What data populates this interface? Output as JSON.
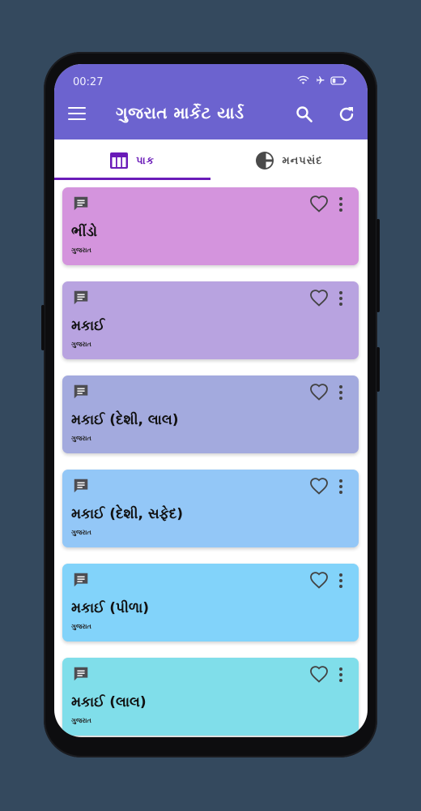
{
  "status_bar": {
    "time": "00:27"
  },
  "app_bar": {
    "title": "ગુજરાત માર્કેટ યાર્ડ"
  },
  "tabs": [
    {
      "label": "પાક",
      "icon": "table-icon",
      "active": true
    },
    {
      "label": "મનપસંદ",
      "icon": "pie-chart-icon",
      "active": false
    }
  ],
  "items": [
    {
      "name": "ભીંડો",
      "state": "ગુજરાત",
      "color": "#d494dd"
    },
    {
      "name": "મકાઈ",
      "state": "ગુજરાત",
      "color": "#b8a3e0"
    },
    {
      "name": "મકાઈ (દેશી, લાલ)",
      "state": "ગુજરાત",
      "color": "#a3aade"
    },
    {
      "name": "મકાઈ (દેશી, સફેદ)",
      "state": "ગુજરાત",
      "color": "#93c7f7"
    },
    {
      "name": "મકાઈ (પીળા)",
      "state": "ગુજરાત",
      "color": "#82d3fa"
    },
    {
      "name": "મકાઈ (લાલ)",
      "state": "ગુજરાત",
      "color": "#80deea"
    }
  ],
  "colors": {
    "primary": "#6c63cf",
    "tab_active": "#6a1bb8",
    "background": "#34495e"
  }
}
